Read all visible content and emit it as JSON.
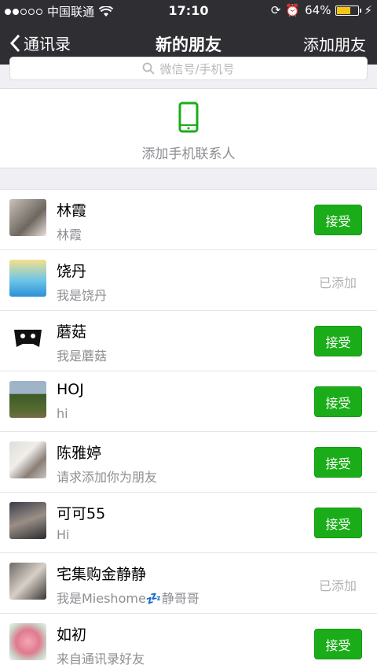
{
  "status_bar": {
    "carrier": "中国联通",
    "time": "17:10",
    "battery": "64%",
    "battery_level": 0.64
  },
  "nav": {
    "back_label": "通讯录",
    "title": "新的朋友",
    "action_label": "添加朋友"
  },
  "search": {
    "placeholder": "微信号/手机号"
  },
  "phone_contacts": {
    "label": "添加手机联系人"
  },
  "colors": {
    "accent_green": "#1aad19",
    "nav_bg": "#2f2e33"
  },
  "requests": [
    {
      "name": "林霞",
      "message": "林霞",
      "status": "接受",
      "accepted": false
    },
    {
      "name": "饶丹",
      "message": "我是饶丹",
      "status": "已添加",
      "accepted": true
    },
    {
      "name": "蘑菇",
      "message": "我是蘑菇",
      "status": "接受",
      "accepted": false
    },
    {
      "name": "HOJ",
      "message": "hi",
      "status": "接受",
      "accepted": false
    },
    {
      "name": "陈雅婷",
      "message": "请求添加你为朋友",
      "status": "接受",
      "accepted": false
    },
    {
      "name": "可可55",
      "message": "Hi",
      "status": "接受",
      "accepted": false
    },
    {
      "name": "宅集购金静静",
      "message": "我是Mieshome💤静哥哥",
      "status": "已添加",
      "accepted": true
    },
    {
      "name": "如初",
      "message": "来自通讯录好友",
      "status": "接受",
      "accepted": false
    }
  ]
}
